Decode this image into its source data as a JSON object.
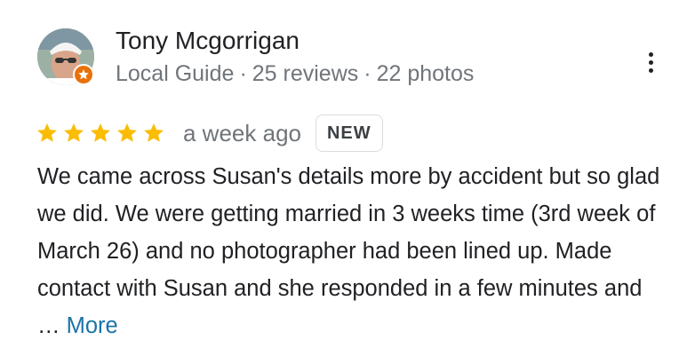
{
  "reviewer": {
    "name": "Tony Mcgorrigan",
    "badge": "Local Guide",
    "reviews": "25 reviews",
    "photos": "22 photos",
    "separator": "·"
  },
  "review": {
    "rating": 5,
    "max_rating": 5,
    "time": "a week ago",
    "new_label": "NEW",
    "text": "We came across Susan's details more by accident but so glad we did. We were getting married in 3 weeks time (3rd week of March 26) and no photographer had been lined up.  Made contact with Susan and she responded in a few minutes and …",
    "more_label": "More"
  },
  "colors": {
    "star": "#fbbc04",
    "link": "#1a73a8",
    "guide_badge": "#e8710a",
    "secondary_text": "#70757a"
  },
  "icons": [
    "avatar",
    "local-guide-icon",
    "more-vert-icon",
    "star-icon"
  ]
}
